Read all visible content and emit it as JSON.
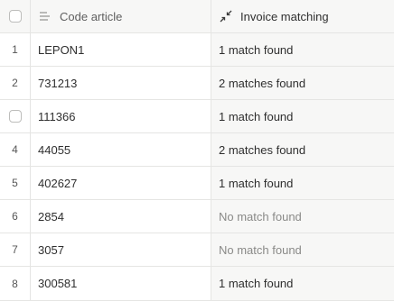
{
  "header": {
    "code_label": "Code article",
    "match_label": "Invoice matching",
    "code_icon": "sort-lines-icon",
    "match_icon": "collapse-arrows-icon"
  },
  "rows": [
    {
      "num": "1",
      "code": "LEPON1",
      "match": "1 match found",
      "found": true
    },
    {
      "num": "2",
      "code": "731213",
      "match": "2 matches found",
      "found": true
    },
    {
      "num": "",
      "code": "111366",
      "match": "1 match found",
      "found": true,
      "checkbox": true
    },
    {
      "num": "4",
      "code": "44055",
      "match": "2 matches found",
      "found": true
    },
    {
      "num": "5",
      "code": "402627",
      "match": "1 match found",
      "found": true
    },
    {
      "num": "6",
      "code": "2854",
      "match": "No match found",
      "found": false
    },
    {
      "num": "7",
      "code": "3057",
      "match": "No match found",
      "found": false
    },
    {
      "num": "8",
      "code": "300581",
      "match": "1 match found",
      "found": true
    }
  ]
}
